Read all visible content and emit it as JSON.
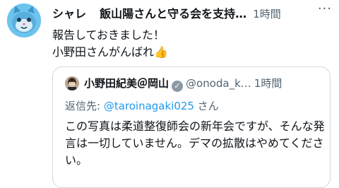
{
  "tweet": {
    "display_name": "シャレ",
    "group_name": "飯山陽さんと守る会を支持…",
    "time": "1時間",
    "more": "···",
    "text_line1": "報告しておきました！",
    "text_line2": "小野田さんがんばれ",
    "emoji": "👍"
  },
  "quoted": {
    "display_name": "小野田紀美＠岡山",
    "verified": "✓",
    "handle": "@onoda_k…",
    "time": "1時間",
    "reply_prefix": "返信先: ",
    "reply_mention": "@taroinagaki025",
    "reply_suffix": " さん",
    "text": "この写真は柔道整復師会の新年会ですが、そんな発言は一切していません。デマの拡散はやめてください。"
  }
}
